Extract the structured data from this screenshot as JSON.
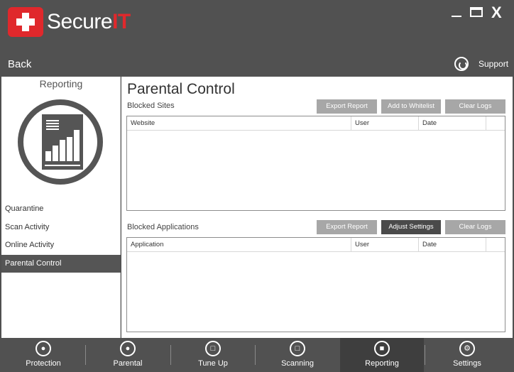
{
  "app": {
    "brand_prefix": "Secure",
    "brand_suffix": "IT",
    "close_label": "X",
    "back_label": "Back",
    "support_label": "Support"
  },
  "sidebar": {
    "title": "Reporting",
    "items": [
      {
        "label": "Quarantine",
        "active": false
      },
      {
        "label": "Scan Activity",
        "active": false
      },
      {
        "label": "Online Activity",
        "active": false
      },
      {
        "label": "Parental Control",
        "active": true
      }
    ]
  },
  "main": {
    "title": "Parental Control",
    "blocked_sites": {
      "label": "Blocked Sites",
      "buttons": [
        "Export Report",
        "Add to Whitelist",
        "Clear Logs"
      ],
      "columns": [
        "Website",
        "User",
        "Date"
      ],
      "rows": []
    },
    "blocked_apps": {
      "label": "Blocked Applications",
      "buttons": [
        "Export Report",
        "Adjust Settings",
        "Clear Logs"
      ],
      "columns": [
        "Application",
        "User",
        "Date"
      ],
      "rows": []
    }
  },
  "bottom_nav": [
    {
      "label": "Protection",
      "icon": "lock-icon"
    },
    {
      "label": "Parental",
      "icon": "person-icon"
    },
    {
      "label": "Tune Up",
      "icon": "gauge-icon"
    },
    {
      "label": "Scanning",
      "icon": "folder-scan-icon"
    },
    {
      "label": "Reporting",
      "icon": "report-icon",
      "active": true
    },
    {
      "label": "Settings",
      "icon": "gear-icon"
    }
  ],
  "colors": {
    "brand_red": "#e0282c",
    "chrome": "#515151",
    "active_item": "#555555",
    "button_gray": "#a7a7a7",
    "button_dark": "#4a4a4a"
  }
}
